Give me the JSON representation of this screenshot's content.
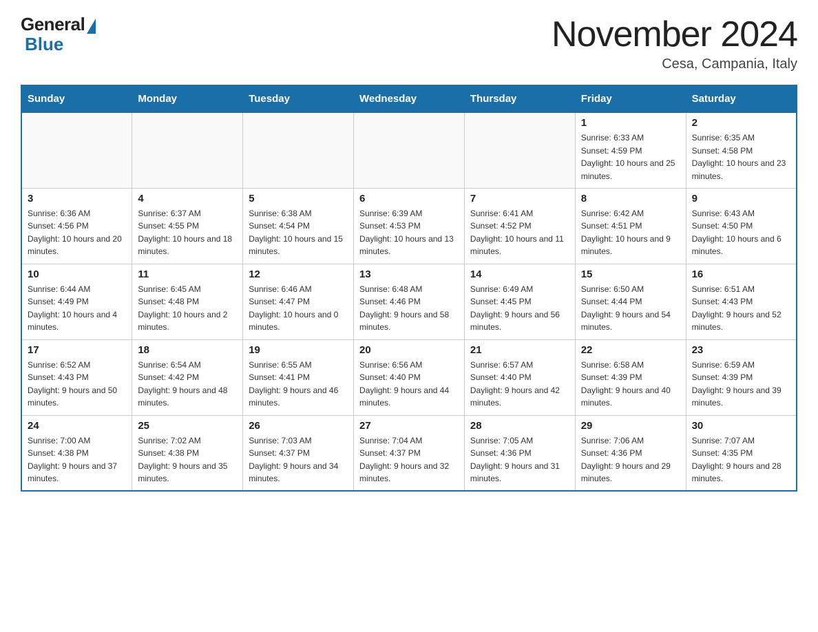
{
  "header": {
    "logo_general": "General",
    "logo_blue": "Blue",
    "month_title": "November 2024",
    "location": "Cesa, Campania, Italy"
  },
  "days_of_week": [
    "Sunday",
    "Monday",
    "Tuesday",
    "Wednesday",
    "Thursday",
    "Friday",
    "Saturday"
  ],
  "weeks": [
    [
      {
        "day": "",
        "info": ""
      },
      {
        "day": "",
        "info": ""
      },
      {
        "day": "",
        "info": ""
      },
      {
        "day": "",
        "info": ""
      },
      {
        "day": "",
        "info": ""
      },
      {
        "day": "1",
        "info": "Sunrise: 6:33 AM\nSunset: 4:59 PM\nDaylight: 10 hours and 25 minutes."
      },
      {
        "day": "2",
        "info": "Sunrise: 6:35 AM\nSunset: 4:58 PM\nDaylight: 10 hours and 23 minutes."
      }
    ],
    [
      {
        "day": "3",
        "info": "Sunrise: 6:36 AM\nSunset: 4:56 PM\nDaylight: 10 hours and 20 minutes."
      },
      {
        "day": "4",
        "info": "Sunrise: 6:37 AM\nSunset: 4:55 PM\nDaylight: 10 hours and 18 minutes."
      },
      {
        "day": "5",
        "info": "Sunrise: 6:38 AM\nSunset: 4:54 PM\nDaylight: 10 hours and 15 minutes."
      },
      {
        "day": "6",
        "info": "Sunrise: 6:39 AM\nSunset: 4:53 PM\nDaylight: 10 hours and 13 minutes."
      },
      {
        "day": "7",
        "info": "Sunrise: 6:41 AM\nSunset: 4:52 PM\nDaylight: 10 hours and 11 minutes."
      },
      {
        "day": "8",
        "info": "Sunrise: 6:42 AM\nSunset: 4:51 PM\nDaylight: 10 hours and 9 minutes."
      },
      {
        "day": "9",
        "info": "Sunrise: 6:43 AM\nSunset: 4:50 PM\nDaylight: 10 hours and 6 minutes."
      }
    ],
    [
      {
        "day": "10",
        "info": "Sunrise: 6:44 AM\nSunset: 4:49 PM\nDaylight: 10 hours and 4 minutes."
      },
      {
        "day": "11",
        "info": "Sunrise: 6:45 AM\nSunset: 4:48 PM\nDaylight: 10 hours and 2 minutes."
      },
      {
        "day": "12",
        "info": "Sunrise: 6:46 AM\nSunset: 4:47 PM\nDaylight: 10 hours and 0 minutes."
      },
      {
        "day": "13",
        "info": "Sunrise: 6:48 AM\nSunset: 4:46 PM\nDaylight: 9 hours and 58 minutes."
      },
      {
        "day": "14",
        "info": "Sunrise: 6:49 AM\nSunset: 4:45 PM\nDaylight: 9 hours and 56 minutes."
      },
      {
        "day": "15",
        "info": "Sunrise: 6:50 AM\nSunset: 4:44 PM\nDaylight: 9 hours and 54 minutes."
      },
      {
        "day": "16",
        "info": "Sunrise: 6:51 AM\nSunset: 4:43 PM\nDaylight: 9 hours and 52 minutes."
      }
    ],
    [
      {
        "day": "17",
        "info": "Sunrise: 6:52 AM\nSunset: 4:43 PM\nDaylight: 9 hours and 50 minutes."
      },
      {
        "day": "18",
        "info": "Sunrise: 6:54 AM\nSunset: 4:42 PM\nDaylight: 9 hours and 48 minutes."
      },
      {
        "day": "19",
        "info": "Sunrise: 6:55 AM\nSunset: 4:41 PM\nDaylight: 9 hours and 46 minutes."
      },
      {
        "day": "20",
        "info": "Sunrise: 6:56 AM\nSunset: 4:40 PM\nDaylight: 9 hours and 44 minutes."
      },
      {
        "day": "21",
        "info": "Sunrise: 6:57 AM\nSunset: 4:40 PM\nDaylight: 9 hours and 42 minutes."
      },
      {
        "day": "22",
        "info": "Sunrise: 6:58 AM\nSunset: 4:39 PM\nDaylight: 9 hours and 40 minutes."
      },
      {
        "day": "23",
        "info": "Sunrise: 6:59 AM\nSunset: 4:39 PM\nDaylight: 9 hours and 39 minutes."
      }
    ],
    [
      {
        "day": "24",
        "info": "Sunrise: 7:00 AM\nSunset: 4:38 PM\nDaylight: 9 hours and 37 minutes."
      },
      {
        "day": "25",
        "info": "Sunrise: 7:02 AM\nSunset: 4:38 PM\nDaylight: 9 hours and 35 minutes."
      },
      {
        "day": "26",
        "info": "Sunrise: 7:03 AM\nSunset: 4:37 PM\nDaylight: 9 hours and 34 minutes."
      },
      {
        "day": "27",
        "info": "Sunrise: 7:04 AM\nSunset: 4:37 PM\nDaylight: 9 hours and 32 minutes."
      },
      {
        "day": "28",
        "info": "Sunrise: 7:05 AM\nSunset: 4:36 PM\nDaylight: 9 hours and 31 minutes."
      },
      {
        "day": "29",
        "info": "Sunrise: 7:06 AM\nSunset: 4:36 PM\nDaylight: 9 hours and 29 minutes."
      },
      {
        "day": "30",
        "info": "Sunrise: 7:07 AM\nSunset: 4:35 PM\nDaylight: 9 hours and 28 minutes."
      }
    ]
  ]
}
